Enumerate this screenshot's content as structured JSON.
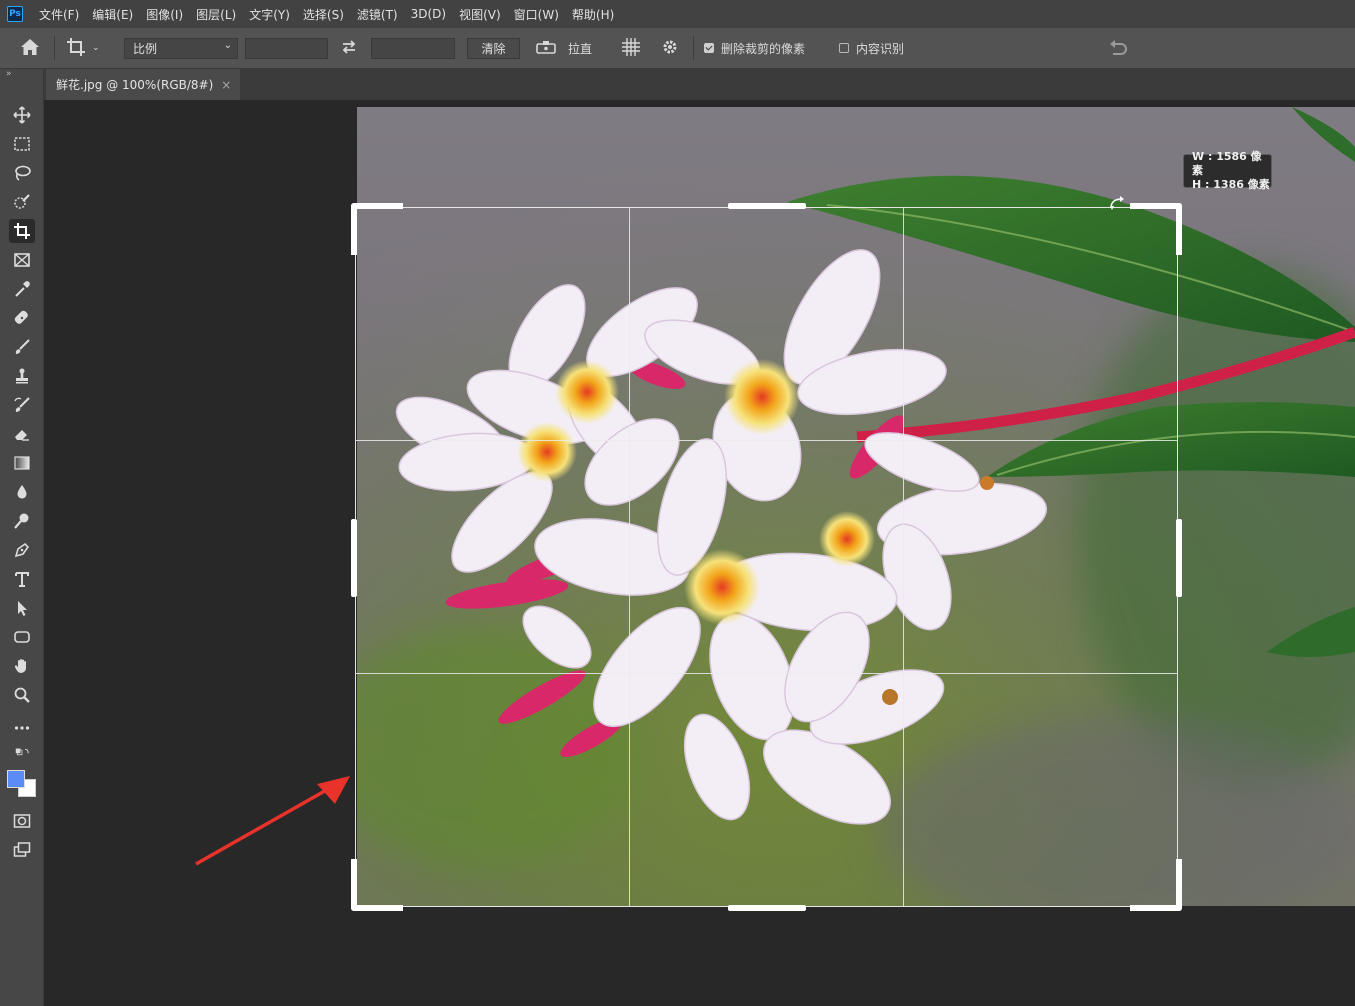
{
  "menubar": {
    "logo": "Ps",
    "items": [
      "文件(F)",
      "编辑(E)",
      "图像(I)",
      "图层(L)",
      "文字(Y)",
      "选择(S)",
      "滤镜(T)",
      "3D(D)",
      "视图(V)",
      "窗口(W)",
      "帮助(H)"
    ]
  },
  "options": {
    "ratio_select": "比例",
    "width_value": "",
    "height_value": "",
    "clear_label": "清除",
    "straighten_label": "拉直",
    "delete_cropped_label": "删除裁剪的像素",
    "delete_cropped_checked": true,
    "content_aware_label": "内容识别",
    "content_aware_checked": false
  },
  "document_tab": {
    "title": "鲜花.jpg @ 100%(RGB/8#)",
    "close": "×"
  },
  "toolbar": {
    "collapse": "»",
    "tools": [
      "move-tool",
      "marquee-tool",
      "lasso-tool",
      "quick-select-tool",
      "crop-tool",
      "frame-tool",
      "eyedropper-tool",
      "healing-brush-tool",
      "brush-tool",
      "clone-stamp-tool",
      "history-brush-tool",
      "eraser-tool",
      "gradient-tool",
      "blur-tool",
      "dodge-tool",
      "pen-tool",
      "type-tool",
      "path-select-tool",
      "shape-tool",
      "hand-tool",
      "zoom-tool",
      "more-tools"
    ],
    "foreground_color": "#5b8cf5",
    "background_color": "#ffffff"
  },
  "crop": {
    "width_line": "W : 1586 像素",
    "height_line": "H : 1386 像素"
  },
  "colors": {
    "accent_arrow": "#e8322a"
  }
}
